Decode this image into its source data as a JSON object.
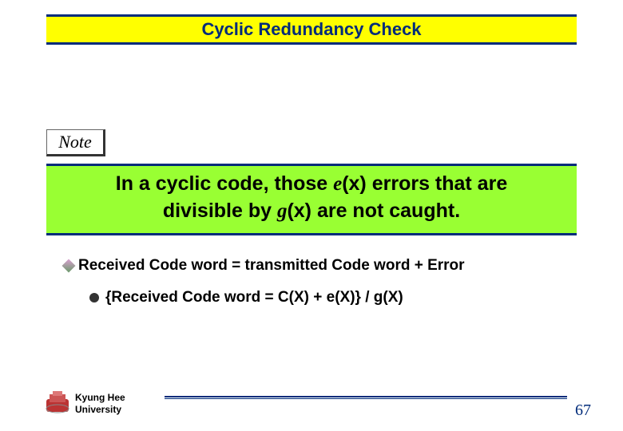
{
  "title": "Cyclic Redundancy Check",
  "note_label": "Note",
  "highlight": {
    "prefix1": "In a cyclic code, those ",
    "e": "e",
    "mid1": "(x) errors that are",
    "prefix2": "divisible by ",
    "g": "g",
    "mid2": "(x) are not caught."
  },
  "bullet1": "Received Code word = transmitted  Code word + Error",
  "bullet2": "{Received Code word = C(X) + e(X)} / g(X)",
  "university_line1": "Kyung Hee",
  "university_line2": "University",
  "page_number": "67"
}
